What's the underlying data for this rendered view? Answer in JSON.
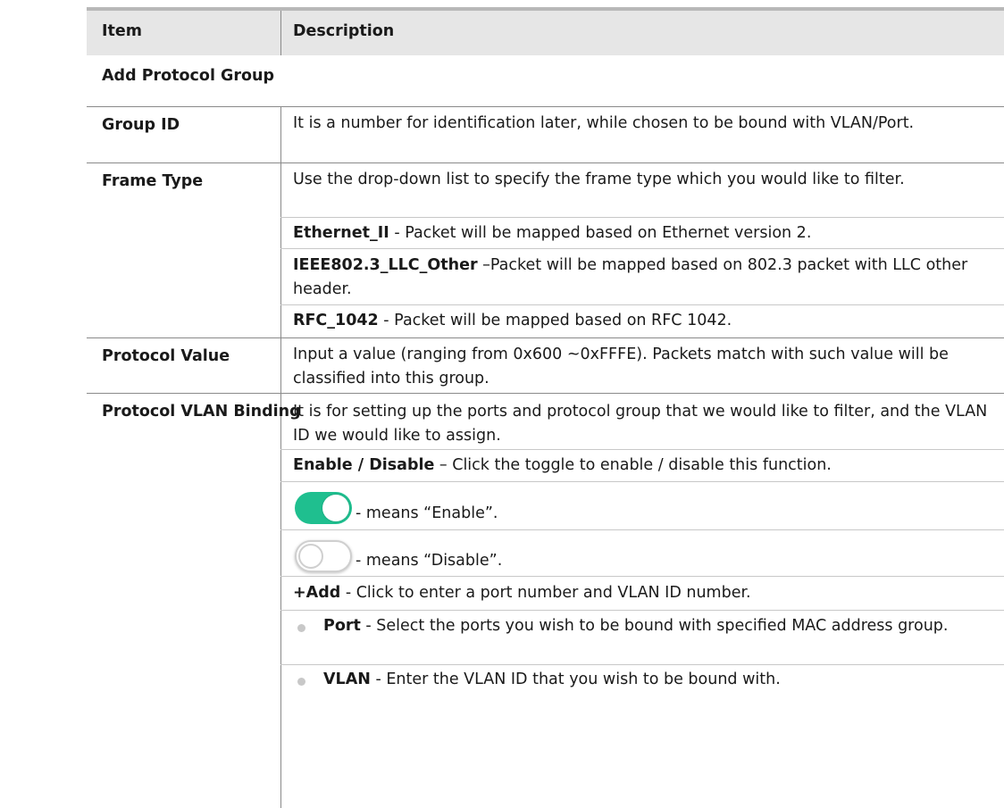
{
  "header": {
    "col_item": "Item",
    "col_description": "Description"
  },
  "section_title": "Add Protocol Group",
  "rows": {
    "group_id": {
      "item": "Group ID",
      "desc": "It is a number for identification later, while chosen to be bound with VLAN/Port."
    },
    "frame_type": {
      "item": "Frame Type",
      "desc": "Use the drop-down list to specify the frame type which you would like to filter.",
      "ethernet_term": "Ethernet_II",
      "ethernet_text": " - Packet will be mapped based on Ethernet version 2.",
      "llc_term": "IEEE802.3_LLC_Other",
      "llc_text": " –Packet will be mapped based on 802.3 packet with LLC other header.",
      "rfc_term": "RFC_1042",
      "rfc_text": " - Packet will be mapped based on RFC 1042."
    },
    "protocol_value": {
      "item": "Protocol Value",
      "desc": "Input a value (ranging from 0x600 ~0xFFFE). Packets match with such value will be classified into this group."
    },
    "binding": {
      "item": "Protocol VLAN Binding",
      "desc": "It is for setting up the ports and protocol group that we would like to filter, and the VLAN ID we would like to assign.",
      "enable_term": "Enable / Disable",
      "enable_text": " – Click the toggle to enable / disable this function.",
      "on_text": "- means “Enable”.",
      "off_text": "- means “Disable”.",
      "add_term": "+Add",
      "add_text": " - Click to enter a port number and VLAN ID number.",
      "port_term": "Port",
      "port_text": " - Select the ports you wish to be bound with specified MAC address group.",
      "vlan_term": "VLAN",
      "vlan_text": " - Enter the VLAN ID that you wish to be bound with."
    }
  },
  "colors": {
    "toggle_on": "#1fbf8f",
    "header_bg": "#e6e6e6"
  }
}
